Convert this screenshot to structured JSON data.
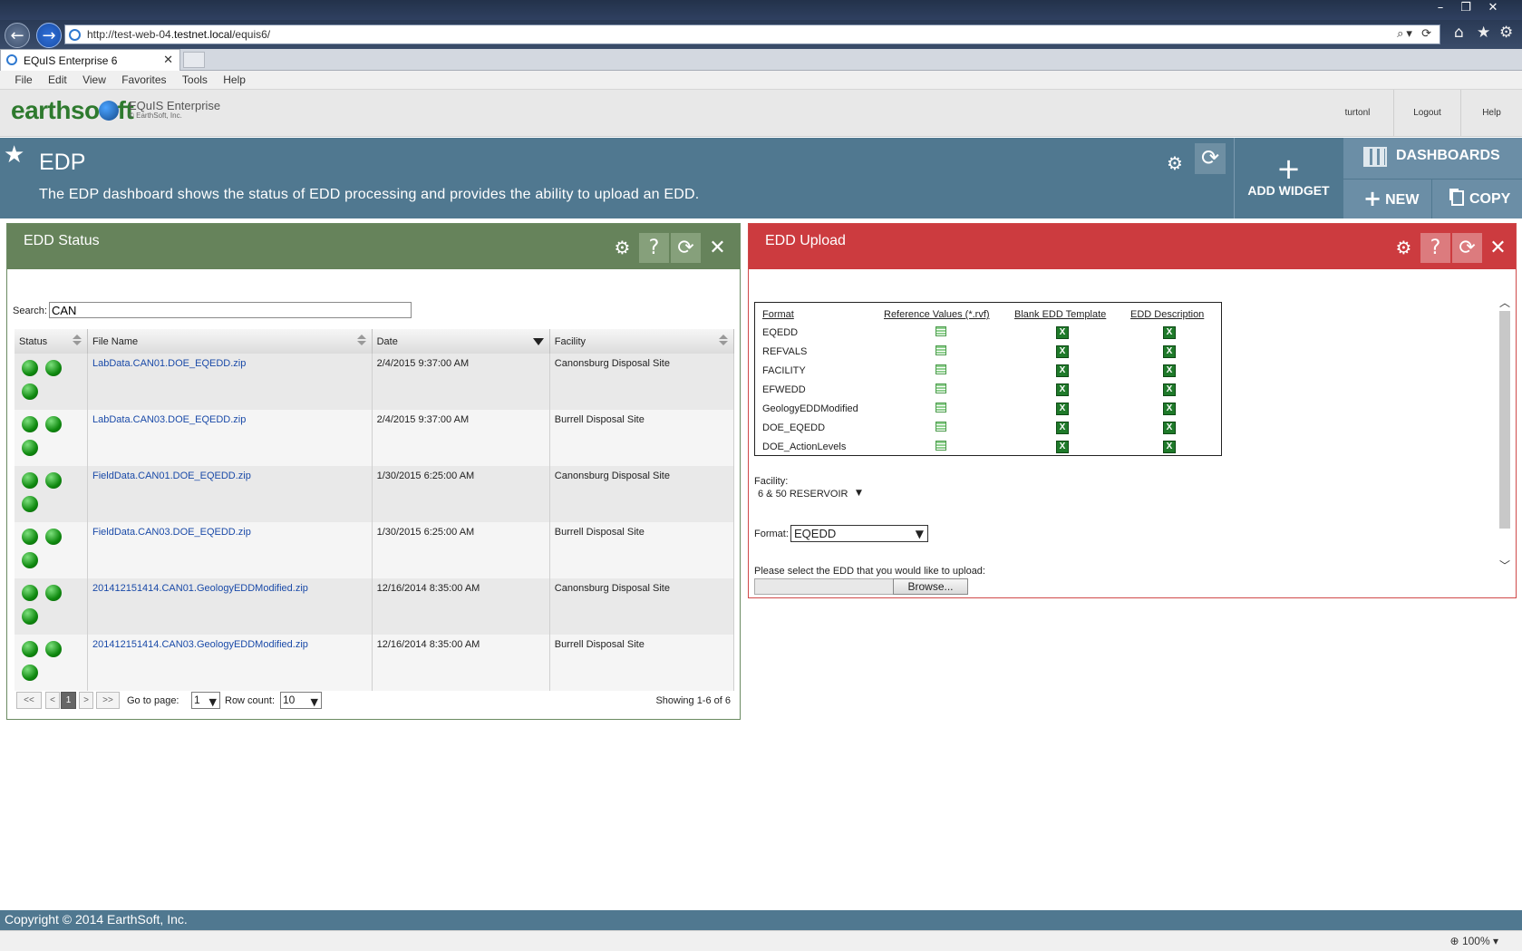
{
  "browser": {
    "window_controls": [
      "–",
      "❐",
      "✕"
    ],
    "url_prefix": "http://test-web-04.",
    "url_domain": "testnet.local",
    "url_suffix": "/equis6/",
    "url_actions": "⌕▾ ⟳",
    "tab_title": "EQuIS Enterprise 6",
    "tab_close": "✕",
    "menu": [
      "File",
      "Edit",
      "View",
      "Favorites",
      "Tools",
      "Help"
    ]
  },
  "header": {
    "logo_left": "earthso",
    "logo_right": "ft",
    "product": "EQuIS Enterprise",
    "copyright_small": "© EarthSoft, Inc.",
    "user": "turtonl",
    "logout": "Logout",
    "help": "Help"
  },
  "dashboard": {
    "title": "EDP",
    "description": "The EDP dashboard shows the status of EDD processing and provides the ability to upload an EDD.",
    "add_widget_label": "ADD WIDGET",
    "dashboards_label": "DASHBOARDS",
    "new_label": "NEW",
    "copy_label": "COPY"
  },
  "edd_status": {
    "title": "EDD Status",
    "search_label": "Search:",
    "search_value": "CAN",
    "columns": [
      "Status",
      "File Name",
      "Date",
      "Facility"
    ],
    "rows": [
      {
        "file": "LabData.CAN01.DOE_EQEDD.zip",
        "date": "2/4/2015 9:37:00 AM",
        "facility": "Canonsburg Disposal Site"
      },
      {
        "file": "LabData.CAN03.DOE_EQEDD.zip",
        "date": "2/4/2015 9:37:00 AM",
        "facility": "Burrell Disposal Site"
      },
      {
        "file": "FieldData.CAN01.DOE_EQEDD.zip",
        "date": "1/30/2015 6:25:00 AM",
        "facility": "Canonsburg Disposal Site"
      },
      {
        "file": "FieldData.CAN03.DOE_EQEDD.zip",
        "date": "1/30/2015 6:25:00 AM",
        "facility": "Burrell Disposal Site"
      },
      {
        "file": "201412151414.CAN01.GeologyEDDModified.zip",
        "date": "12/16/2014 8:35:00 AM",
        "facility": "Canonsburg Disposal Site"
      },
      {
        "file": "201412151414.CAN03.GeologyEDDModified.zip",
        "date": "12/16/2014 8:35:00 AM",
        "facility": "Burrell Disposal Site"
      }
    ],
    "pager": {
      "first": "<<",
      "prev": "<",
      "current": "1",
      "next": ">",
      "last": ">>",
      "goto_label": "Go to page:",
      "goto_value": "1",
      "rowcount_label": "Row count:",
      "rowcount_value": "10",
      "showing": "Showing 1-6 of 6"
    }
  },
  "edd_upload": {
    "title": "EDD Upload",
    "columns": [
      "Format",
      "Reference Values (*.rvf)",
      "Blank EDD Template",
      "EDD Description"
    ],
    "formats": [
      "EQEDD",
      "REFVALS",
      "FACILITY",
      "EFWEDD",
      "GeologyEDDModified",
      "DOE_EQEDD",
      "DOE_ActionLevels"
    ],
    "facility_label": "Facility:",
    "facility_value": "6 & 50 RESERVOIR",
    "format_label": "Format:",
    "format_value": "EQEDD",
    "prompt": "Please select the EDD that you would like to upload:",
    "browse_label": "Browse..."
  },
  "footer": {
    "copyright": "Copyright © 2014 EarthSoft, Inc.",
    "zoom": "100%"
  },
  "colors": {
    "dashboard_bar": "#507890",
    "status_header": "#66835b",
    "upload_header": "#cc3b3f",
    "status_ok": "#108a10",
    "link": "#1a4aa8"
  }
}
